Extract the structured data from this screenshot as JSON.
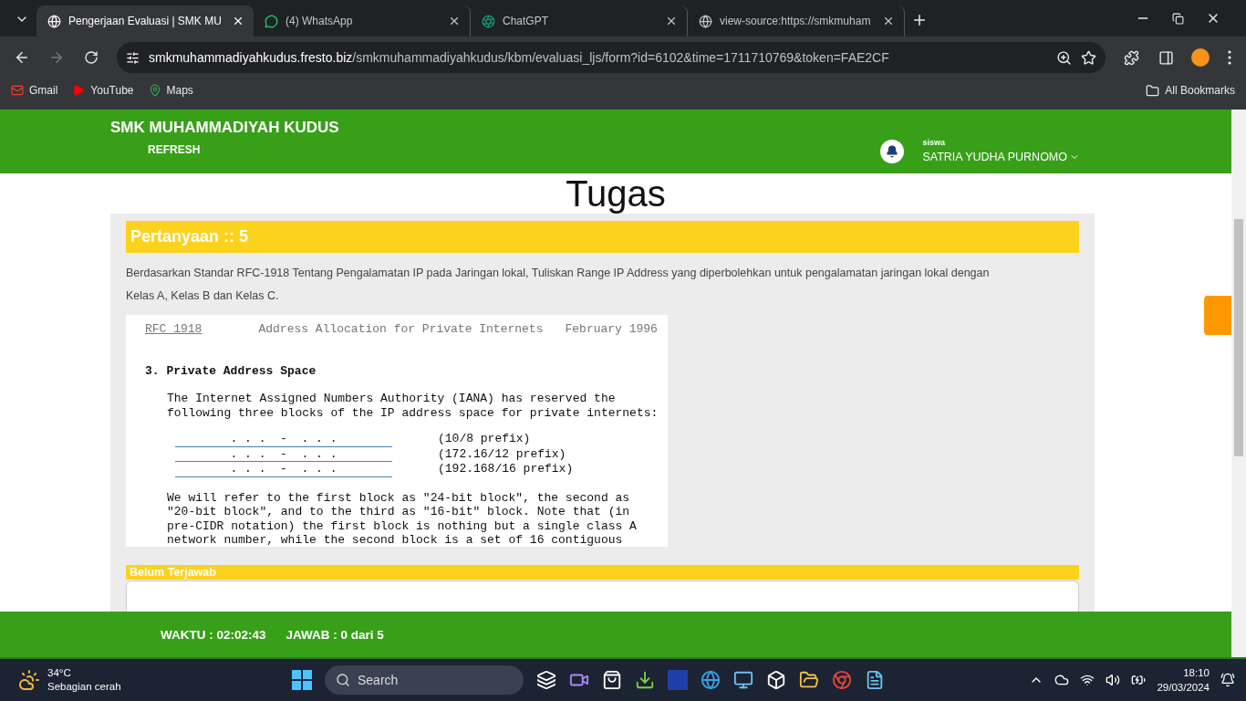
{
  "browser": {
    "tabs": [
      {
        "title": "Pengerjaan Evaluasi | SMK MU",
        "selected": true
      },
      {
        "title": "(4) WhatsApp",
        "selected": false
      },
      {
        "title": "ChatGPT",
        "selected": false
      },
      {
        "title": "view-source:https://smkmuham",
        "selected": false
      }
    ],
    "address": {
      "host": "smkmuhammadiyahkudus.fresto.biz",
      "path": "/smkmuhammadiyahkudus/kbm/evaluasi_ljs/form?id=6102&time=1711710769&token=FAE2CF"
    },
    "bookmarks": [
      {
        "label": "Gmail"
      },
      {
        "label": "YouTube"
      },
      {
        "label": "Maps"
      }
    ],
    "all_bookmarks": "All Bookmarks"
  },
  "page": {
    "header": {
      "school": "SMK MUHAMMADIYAH KUDUS",
      "refresh": "REFRESH",
      "role": "siswa",
      "user": "SATRIA YUDHA PURNOMO"
    },
    "title": "Tugas",
    "question": {
      "heading": "Pertanyaan :: 5",
      "text": [
        "Berdasarkan Standar RFC-1918 Tentang Pengalamatan IP pada Jaringan lokal, Tuliskan Range IP Address yang diperbolehkan untuk pengalamatan jaringan lokal dengan",
        "Kelas A, Kelas B dan Kelas C."
      ],
      "document": {
        "rfc": "RFC 1918",
        "doc_title": "Address Allocation for Private Internets",
        "date": "February 1996",
        "section": "3. Private Address Space",
        "intro": [
          "The Internet Assigned Numbers Authority (IANA) has reserved the",
          "following three blocks of the IP address space for private internets:"
        ],
        "blanks": [
          {
            "pattern": ". . .  -  . . .",
            "prefix": "(10/8 prefix)"
          },
          {
            "pattern": ". . .  -  . . .",
            "prefix": "(172.16/12 prefix)"
          },
          {
            "pattern": ". . .  -  . . .",
            "prefix": "(192.168/16 prefix)"
          }
        ],
        "outro": [
          "We will refer to the first block as \"24-bit block\", the second as",
          "\"20-bit block\", and to the third as \"16-bit\" block. Note that (in",
          "pre-CIDR notation) the first block is nothing but a single class A",
          "network number, while the second block is a set of 16 contiguous"
        ]
      }
    },
    "status": "Belum Terjawab",
    "footer": {
      "timer": "WAKTU : 02:02:43",
      "answered": "JAWAB : 0 dari 5"
    }
  },
  "taskbar": {
    "weather": {
      "temp": "34°C",
      "desc": "Sebagian cerah"
    },
    "search": "Search",
    "time": "18:10",
    "date": "29/03/2024"
  }
}
